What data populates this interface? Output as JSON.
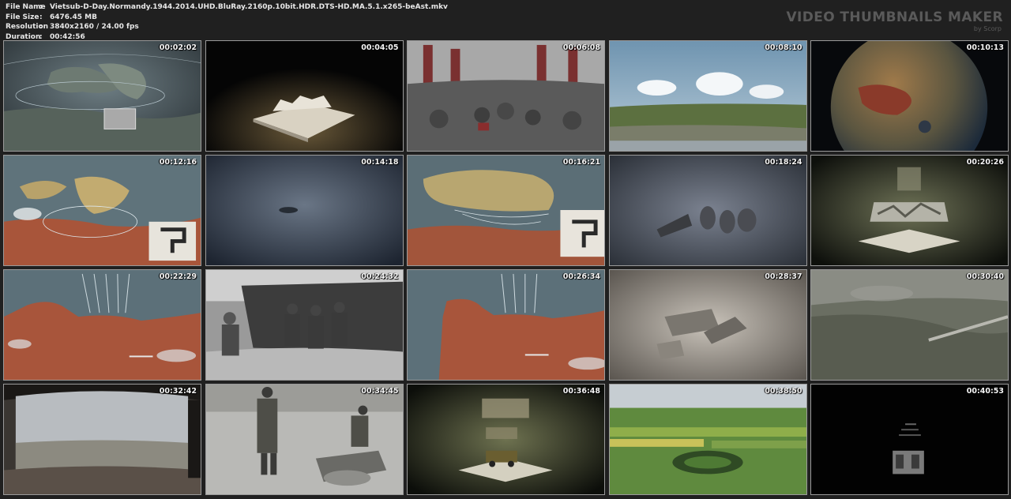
{
  "file_info": [
    {
      "label": "File Name",
      "value": "Vietsub-D-Day.Normandy.1944.2014.UHD.BluRay.2160p.10bit.HDR.DTS-HD.MA.5.1.x265-beAst.mkv"
    },
    {
      "label": "File Size",
      "value": "6476.45 MB"
    },
    {
      "label": "Resolution",
      "value": "3840x2160 / 24.00 fps"
    },
    {
      "label": "Duration",
      "value": "00:42:56"
    }
  ],
  "separator": ":",
  "brand": {
    "title": "VIDEO THUMBNAILS MAKER",
    "subtitle": "by Scorp"
  },
  "thumbnails": [
    {
      "time": "00:02:02",
      "scene": "map-british-isles"
    },
    {
      "time": "00:04:05",
      "scene": "popup-book-credits"
    },
    {
      "time": "00:06:08",
      "scene": "crowd-rally"
    },
    {
      "time": "00:08:10",
      "scene": "coast-cliffs"
    },
    {
      "time": "00:10:13",
      "scene": "globe-europe"
    },
    {
      "time": "00:12:16",
      "scene": "map-uk-red"
    },
    {
      "time": "00:14:18",
      "scene": "blue-smoke"
    },
    {
      "time": "00:16:21",
      "scene": "map-channel"
    },
    {
      "time": "00:18:24",
      "scene": "sketch-soldiers"
    },
    {
      "time": "00:20:26",
      "scene": "popup-c47"
    },
    {
      "time": "00:22:29",
      "scene": "map-normandy"
    },
    {
      "time": "00:24:32",
      "scene": "landing-craft"
    },
    {
      "time": "00:26:34",
      "scene": "map-normandy-2"
    },
    {
      "time": "00:28:37",
      "scene": "sketch-logs"
    },
    {
      "time": "00:30:40",
      "scene": "aerial-battlefield"
    },
    {
      "time": "00:32:42",
      "scene": "panorama-beach"
    },
    {
      "time": "00:34:45",
      "scene": "soldiers-field"
    },
    {
      "time": "00:36:48",
      "scene": "popup-jeep"
    },
    {
      "time": "00:38:50",
      "scene": "aerial-fields"
    },
    {
      "time": "00:40:53",
      "scene": "black-credits"
    }
  ]
}
